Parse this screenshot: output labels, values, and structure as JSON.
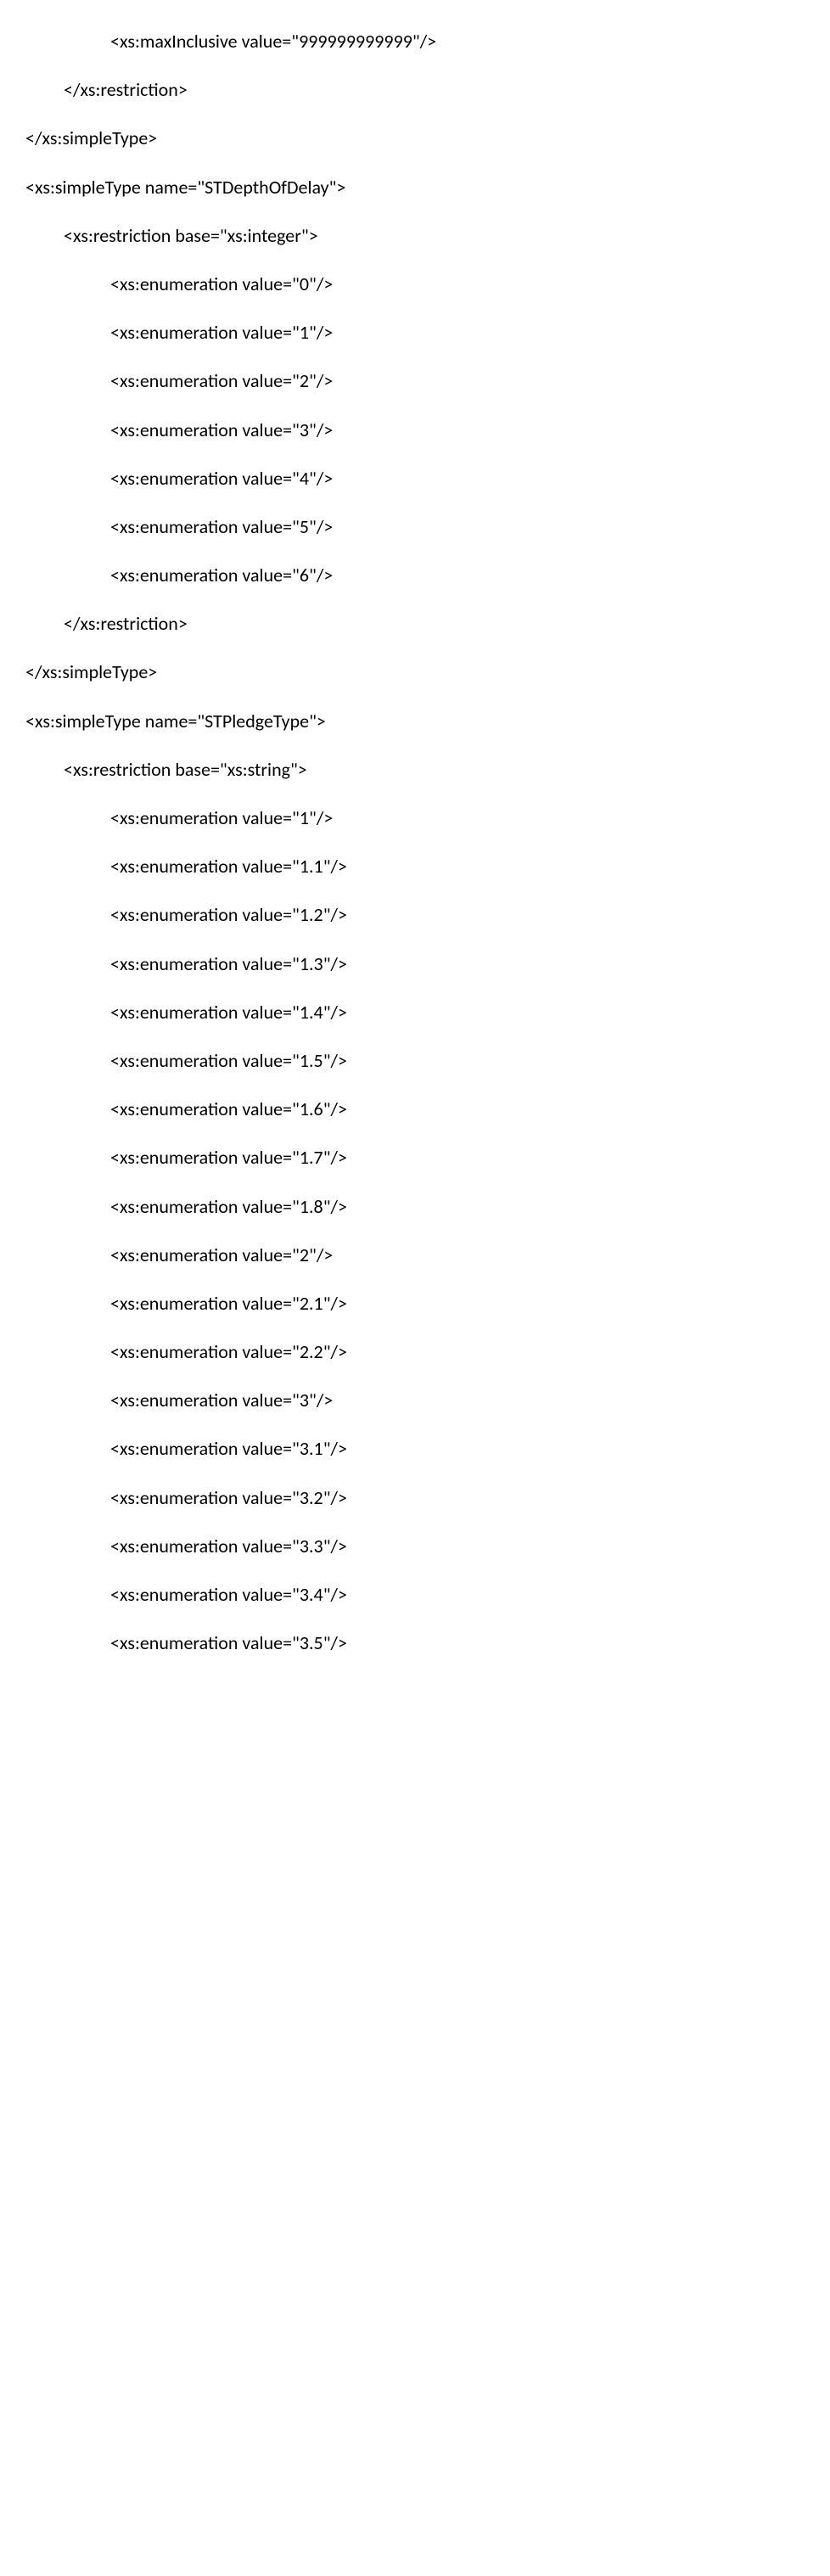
{
  "lines": [
    {
      "indent": 3,
      "text": "<xs:maxInclusive value=\"999999999999\"/>"
    },
    {
      "indent": 2,
      "text": "</xs:restriction>"
    },
    {
      "indent": 1,
      "text": "</xs:simpleType>"
    },
    {
      "indent": 1,
      "text": "<xs:simpleType name=\"STDepthOfDelay\">"
    },
    {
      "indent": 2,
      "text": "<xs:restriction base=\"xs:integer\">"
    },
    {
      "indent": 3,
      "text": "<xs:enumeration value=\"0\"/>"
    },
    {
      "indent": 3,
      "text": "<xs:enumeration value=\"1\"/>"
    },
    {
      "indent": 3,
      "text": "<xs:enumeration value=\"2\"/>"
    },
    {
      "indent": 3,
      "text": "<xs:enumeration value=\"3\"/>"
    },
    {
      "indent": 3,
      "text": "<xs:enumeration value=\"4\"/>"
    },
    {
      "indent": 3,
      "text": "<xs:enumeration value=\"5\"/>"
    },
    {
      "indent": 3,
      "text": "<xs:enumeration value=\"6\"/>"
    },
    {
      "indent": 2,
      "text": "</xs:restriction>"
    },
    {
      "indent": 1,
      "text": "</xs:simpleType>"
    },
    {
      "indent": 1,
      "text": "<xs:simpleType name=\"STPledgeType\">"
    },
    {
      "indent": 2,
      "text": "<xs:restriction base=\"xs:string\">"
    },
    {
      "indent": 3,
      "text": "<xs:enumeration value=\"1\"/>"
    },
    {
      "indent": 3,
      "text": "<xs:enumeration value=\"1.1\"/>"
    },
    {
      "indent": 3,
      "text": "<xs:enumeration value=\"1.2\"/>"
    },
    {
      "indent": 3,
      "text": "<xs:enumeration value=\"1.3\"/>"
    },
    {
      "indent": 3,
      "text": "<xs:enumeration value=\"1.4\"/>"
    },
    {
      "indent": 3,
      "text": "<xs:enumeration value=\"1.5\"/>"
    },
    {
      "indent": 3,
      "text": "<xs:enumeration value=\"1.6\"/>"
    },
    {
      "indent": 3,
      "text": "<xs:enumeration value=\"1.7\"/>"
    },
    {
      "indent": 3,
      "text": "<xs:enumeration value=\"1.8\"/>"
    },
    {
      "indent": 3,
      "text": "<xs:enumeration value=\"2\"/>"
    },
    {
      "indent": 3,
      "text": "<xs:enumeration value=\"2.1\"/>"
    },
    {
      "indent": 3,
      "text": "<xs:enumeration value=\"2.2\"/>"
    },
    {
      "indent": 3,
      "text": "<xs:enumeration value=\"3\"/>"
    },
    {
      "indent": 3,
      "text": "<xs:enumeration value=\"3.1\"/>"
    },
    {
      "indent": 3,
      "text": "<xs:enumeration value=\"3.2\"/>"
    },
    {
      "indent": 3,
      "text": "<xs:enumeration value=\"3.3\"/>"
    },
    {
      "indent": 3,
      "text": "<xs:enumeration value=\"3.4\"/>"
    },
    {
      "indent": 3,
      "text": "<xs:enumeration value=\"3.5\"/>"
    }
  ]
}
